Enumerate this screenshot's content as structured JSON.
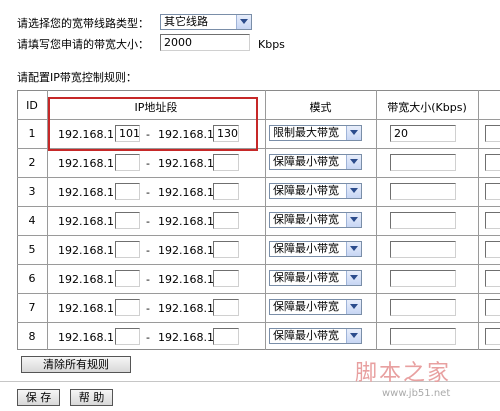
{
  "form": {
    "line_type_label": "请选择您的宽带线路类型：",
    "line_type_value": "其它线路",
    "bandwidth_label": "请填写您申请的带宽大小：",
    "bandwidth_value": "2000",
    "bandwidth_unit": "Kbps",
    "rules_heading": "请配置IP带宽控制规则："
  },
  "table": {
    "headers": {
      "id": "ID",
      "ip": "IP地址段",
      "mode": "模式",
      "bw": "带宽大小(Kbps)"
    },
    "ip_prefix": "192.168.1.",
    "separator": "-",
    "rows": [
      {
        "id": "1",
        "start": "101",
        "end": "130",
        "mode": "限制最大带宽",
        "bandwidth": "20"
      },
      {
        "id": "2",
        "start": "",
        "end": "",
        "mode": "保障最小带宽",
        "bandwidth": ""
      },
      {
        "id": "3",
        "start": "",
        "end": "",
        "mode": "保障最小带宽",
        "bandwidth": ""
      },
      {
        "id": "4",
        "start": "",
        "end": "",
        "mode": "保障最小带宽",
        "bandwidth": ""
      },
      {
        "id": "5",
        "start": "",
        "end": "",
        "mode": "保障最小带宽",
        "bandwidth": ""
      },
      {
        "id": "6",
        "start": "",
        "end": "",
        "mode": "保障最小带宽",
        "bandwidth": ""
      },
      {
        "id": "7",
        "start": "",
        "end": "",
        "mode": "保障最小带宽",
        "bandwidth": ""
      },
      {
        "id": "8",
        "start": "",
        "end": "",
        "mode": "保障最小带宽",
        "bandwidth": ""
      }
    ]
  },
  "buttons": {
    "clear_rules": "清除所有规则",
    "save": "保 存",
    "help": "帮 助"
  },
  "watermark": {
    "text": "脚本之家",
    "url": "www.jb51.net"
  }
}
